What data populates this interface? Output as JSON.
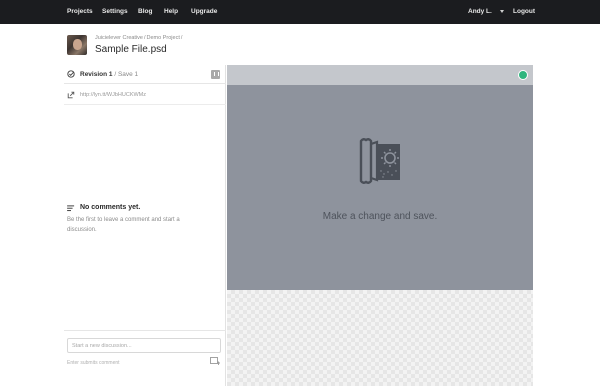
{
  "nav": {
    "items": [
      {
        "label": "Projects"
      },
      {
        "label": "Settings"
      },
      {
        "label": "Blog"
      },
      {
        "label": "Help"
      },
      {
        "label": "Upgrade"
      }
    ],
    "user_name": "Andy L.",
    "logout_label": "Logout"
  },
  "breadcrumb": {
    "team": "Juicielever Creative",
    "project": "Demo Project",
    "separator": "/"
  },
  "file_title": "Sample File.psd",
  "revision": {
    "label": "Revision 1",
    "separator": " / ",
    "save_label": "Save 1"
  },
  "share_url": "http://lyn.tt/WJbHUCKWMz",
  "comments": {
    "title": "No comments yet.",
    "description": "Be the first to leave a comment and start a discussion."
  },
  "discussion": {
    "placeholder": "Start a new discussion...",
    "submit_hint": "Enter submits comment"
  },
  "preview": {
    "message": "Make a change and save."
  },
  "colors": {
    "topbar": "#1b1c1f",
    "preview_bg": "#8e939d",
    "status": "#2fb57e"
  },
  "icons": [
    "check-circle-icon",
    "download-icon",
    "share-arrow-icon",
    "comments-lines-icon",
    "add-comment-icon",
    "open-door-icon",
    "status-dot-icon",
    "caret-down-icon"
  ]
}
